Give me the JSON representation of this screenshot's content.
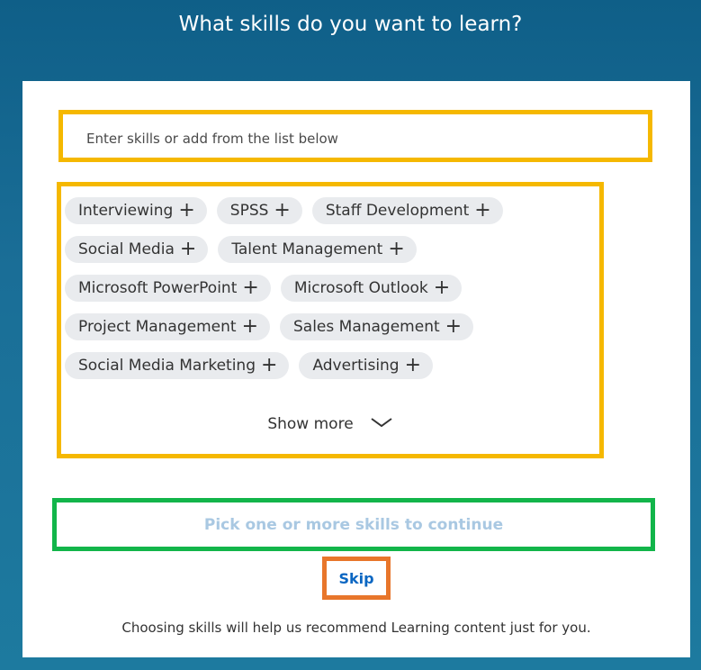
{
  "header": {
    "title": "What skills do you want to learn?"
  },
  "search": {
    "placeholder": "Enter skills or add from the list below",
    "value": ""
  },
  "skills": {
    "items": [
      "Interviewing",
      "SPSS",
      "Staff Development",
      "Social Media",
      "Talent Management",
      "Microsoft PowerPoint",
      "Microsoft Outlook",
      "Project Management",
      "Sales Management",
      "Social Media Marketing",
      "Advertising"
    ],
    "add_icon": "plus-icon",
    "show_more_label": "Show more",
    "show_more_icon": "chevron-down-icon"
  },
  "actions": {
    "continue_label": "Pick one or more skills to continue",
    "skip_label": "Skip"
  },
  "footer": {
    "text": "Choosing skills will help us recommend Learning content just for you."
  },
  "colors": {
    "background": "#136791",
    "card": "#ffffff",
    "chip": "#e9ebee",
    "continue_disabled_text": "#a9c8e2",
    "skip_text": "#0a66c2",
    "annotation_search": "#f5b800",
    "annotation_skills": "#f5b800",
    "annotation_continue": "#12b54a",
    "annotation_skip": "#e8762b"
  }
}
